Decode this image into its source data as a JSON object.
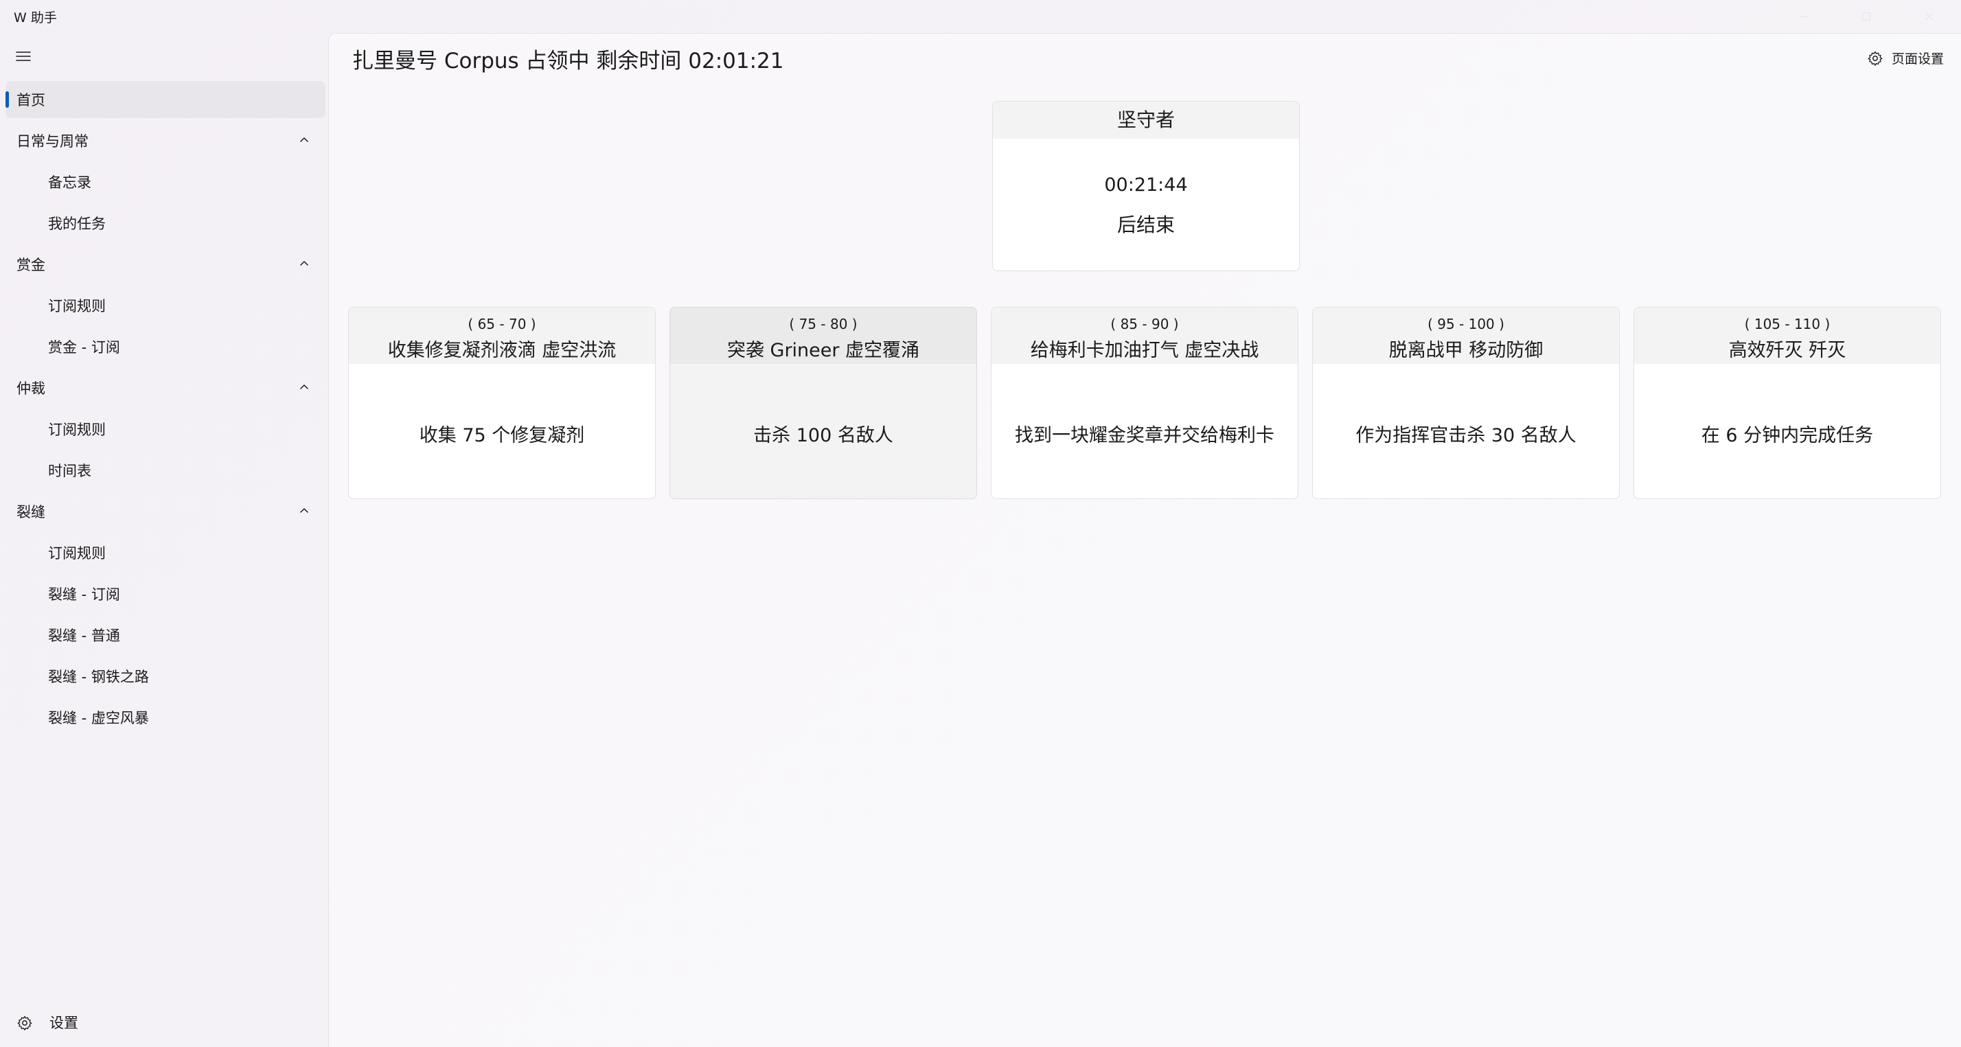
{
  "app": {
    "title": "W 助手"
  },
  "sidebar": {
    "items": [
      {
        "label": "首页",
        "selected": true
      },
      {
        "label": "日常与周常",
        "expanded": true
      },
      {
        "label": "备忘录"
      },
      {
        "label": "我的任务"
      },
      {
        "label": "赏金",
        "expanded": true
      },
      {
        "label": "订阅规则"
      },
      {
        "label": "赏金 - 订阅"
      },
      {
        "label": "仲裁",
        "expanded": true
      },
      {
        "label": "订阅规则"
      },
      {
        "label": "时间表"
      },
      {
        "label": "裂缝",
        "expanded": true
      },
      {
        "label": "订阅规则"
      },
      {
        "label": "裂缝 - 订阅"
      },
      {
        "label": "裂缝 - 普通"
      },
      {
        "label": "裂缝 - 钢铁之路"
      },
      {
        "label": "裂缝 - 虚空风暴"
      }
    ],
    "settings_label": "设置"
  },
  "header": {
    "title": "扎里曼号 Corpus 占领中 剩余时间 02:01:21",
    "page_settings_label": "页面设置"
  },
  "sentinel": {
    "title": "坚守者",
    "time": "00:21:44",
    "suffix": "后结束"
  },
  "missions": [
    {
      "range": "( 65 - 70 )",
      "name": "收集修复凝剂液滴 虚空洪流",
      "desc": "收集 75 个修复凝剂"
    },
    {
      "range": "( 75 - 80 )",
      "name": "突袭 Grineer 虚空覆涌",
      "desc": "击杀 100 名敌人"
    },
    {
      "range": "( 85 - 90 )",
      "name": "给梅利卡加油打气 虚空决战",
      "desc": "找到一块耀金奖章并交给梅利卡"
    },
    {
      "range": "( 95 - 100 )",
      "name": "脱离战甲 移动防御",
      "desc": "作为指挥官击杀 30 名敌人"
    },
    {
      "range": "( 105 - 110 )",
      "name": "高效歼灭 歼灭",
      "desc": "在 6 分钟内完成任务"
    }
  ],
  "colors": {
    "accent": "#0a5fb4",
    "selected_bg": "#e9e6eb",
    "card_head": "#f4f3f4"
  },
  "icons": {
    "menu": "hamburger-icon",
    "expand": "chevron-up-icon",
    "settings": "gear-icon"
  }
}
